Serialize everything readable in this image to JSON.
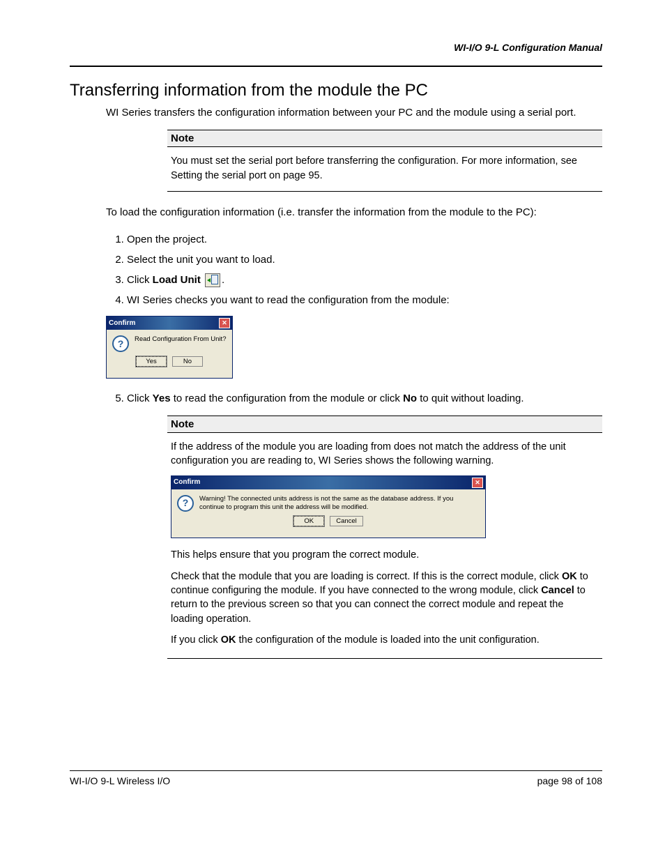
{
  "header": {
    "doc_title": "WI-I/O 9-L Configuration Manual"
  },
  "section": {
    "title": "Transferring information from the module the PC",
    "intro": "WI Series transfers the configuration information between your PC and the module using a serial port.",
    "to_load": "To load  the configuration information (i.e. transfer the information from the module to the PC):"
  },
  "note1": {
    "label": "Note",
    "text": "You must set the serial port before transferring the configuration. For more information, see Setting the serial port on page 95."
  },
  "steps": {
    "s1": "Open the project.",
    "s2": "Select the unit you want to load.",
    "s3_pre": "Click ",
    "s3_bold": "Load Unit",
    "s3_post": " .",
    "s4": "WI Series checks you want to read the configuration from the module:",
    "s5_pre": "Click ",
    "s5_b1": "Yes",
    "s5_mid": " to read the configuration from the module or click ",
    "s5_b2": "No",
    "s5_post": " to quit without loading."
  },
  "dialog1": {
    "title": "Confirm",
    "text": "Read Configuration From Unit?",
    "yes": "Yes",
    "no": "No"
  },
  "note2": {
    "label": "Note",
    "p1": "If the address of the module you are loading from does not match the address of the unit configuration you are reading to, WI Series shows the following warning.",
    "p2": "This helps ensure that you program the correct module.",
    "p3_pre": "Check that the module that you are loading is correct. If this is the correct module, click ",
    "p3_b1": "OK",
    "p3_mid": " to continue configuring the module. If you have connected to the wrong module, click ",
    "p3_b2": "Cancel",
    "p3_post": " to return to the previous screen so that you can connect the correct module and repeat the loading operation.",
    "p4_pre": "If you click ",
    "p4_b1": "OK",
    "p4_post": " the configuration of the module is loaded into the unit configuration."
  },
  "dialog2": {
    "title": "Confirm",
    "text": "Warning! The connected units address is not the same as the database address.  If you continue to program this unit the address will be modified.",
    "ok": "OK",
    "cancel": "Cancel"
  },
  "footer": {
    "left": "WI-I/O 9-L Wireless I/O",
    "right": "page  98 of 108"
  }
}
